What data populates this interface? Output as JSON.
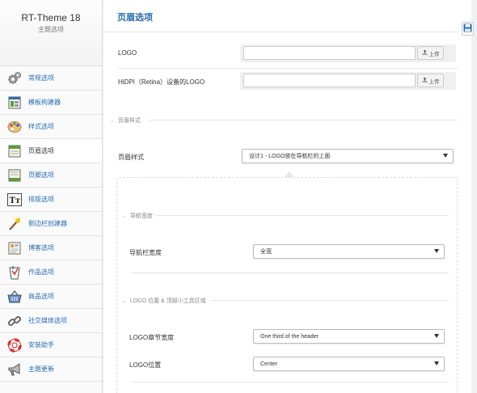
{
  "brand": {
    "title": "RT-Theme 18",
    "subtitle": "主题选项"
  },
  "sidebar": {
    "items": [
      {
        "label": "常规选项",
        "icon": "gears-icon"
      },
      {
        "label": "模板构建器",
        "icon": "template-icon"
      },
      {
        "label": "样式选项",
        "icon": "palette-icon"
      },
      {
        "label": "页眉选项",
        "icon": "header-layout-icon",
        "active": true
      },
      {
        "label": "页脚选项",
        "icon": "footer-layout-icon"
      },
      {
        "label": "排版选项",
        "icon": "typography-icon"
      },
      {
        "label": "侧边栏创建器",
        "icon": "magic-wand-icon"
      },
      {
        "label": "博客选项",
        "icon": "blog-icon"
      },
      {
        "label": "作品选项",
        "icon": "portfolio-icon"
      },
      {
        "label": "商品选项",
        "icon": "basket-icon"
      },
      {
        "label": "社交媒体选项",
        "icon": "chain-link-icon"
      },
      {
        "label": "安装助手",
        "icon": "lifebuoy-icon"
      },
      {
        "label": "主题更新",
        "icon": "megaphone-icon"
      }
    ]
  },
  "main": {
    "title": "页眉选项",
    "logo": {
      "label": "LOGO",
      "value": "",
      "upload_label": "上传"
    },
    "logo_retina": {
      "label": "HiDPI（Retina）设备的LOGO",
      "value": "",
      "upload_label": "上传"
    },
    "header_style_section": "页眉样式",
    "header_style": {
      "label": "页眉样式",
      "value": "设计1 - LOGO放在导航栏的上面"
    },
    "nav_width_section": "导航宽度",
    "nav_width": {
      "label": "导航栏宽度",
      "value": "全宽"
    },
    "logo_area_section": "LOGO 位置 & 顶部小工具区域",
    "logo_section_width": {
      "label": "LOGO章节宽度",
      "value": "One third of the header"
    },
    "logo_position": {
      "label": "LOGO位置",
      "value": "Center"
    }
  },
  "colors": {
    "accent": "#2a6db0",
    "sidebar_bg": "#fafafa",
    "page_bg": "#f1f1f1"
  }
}
